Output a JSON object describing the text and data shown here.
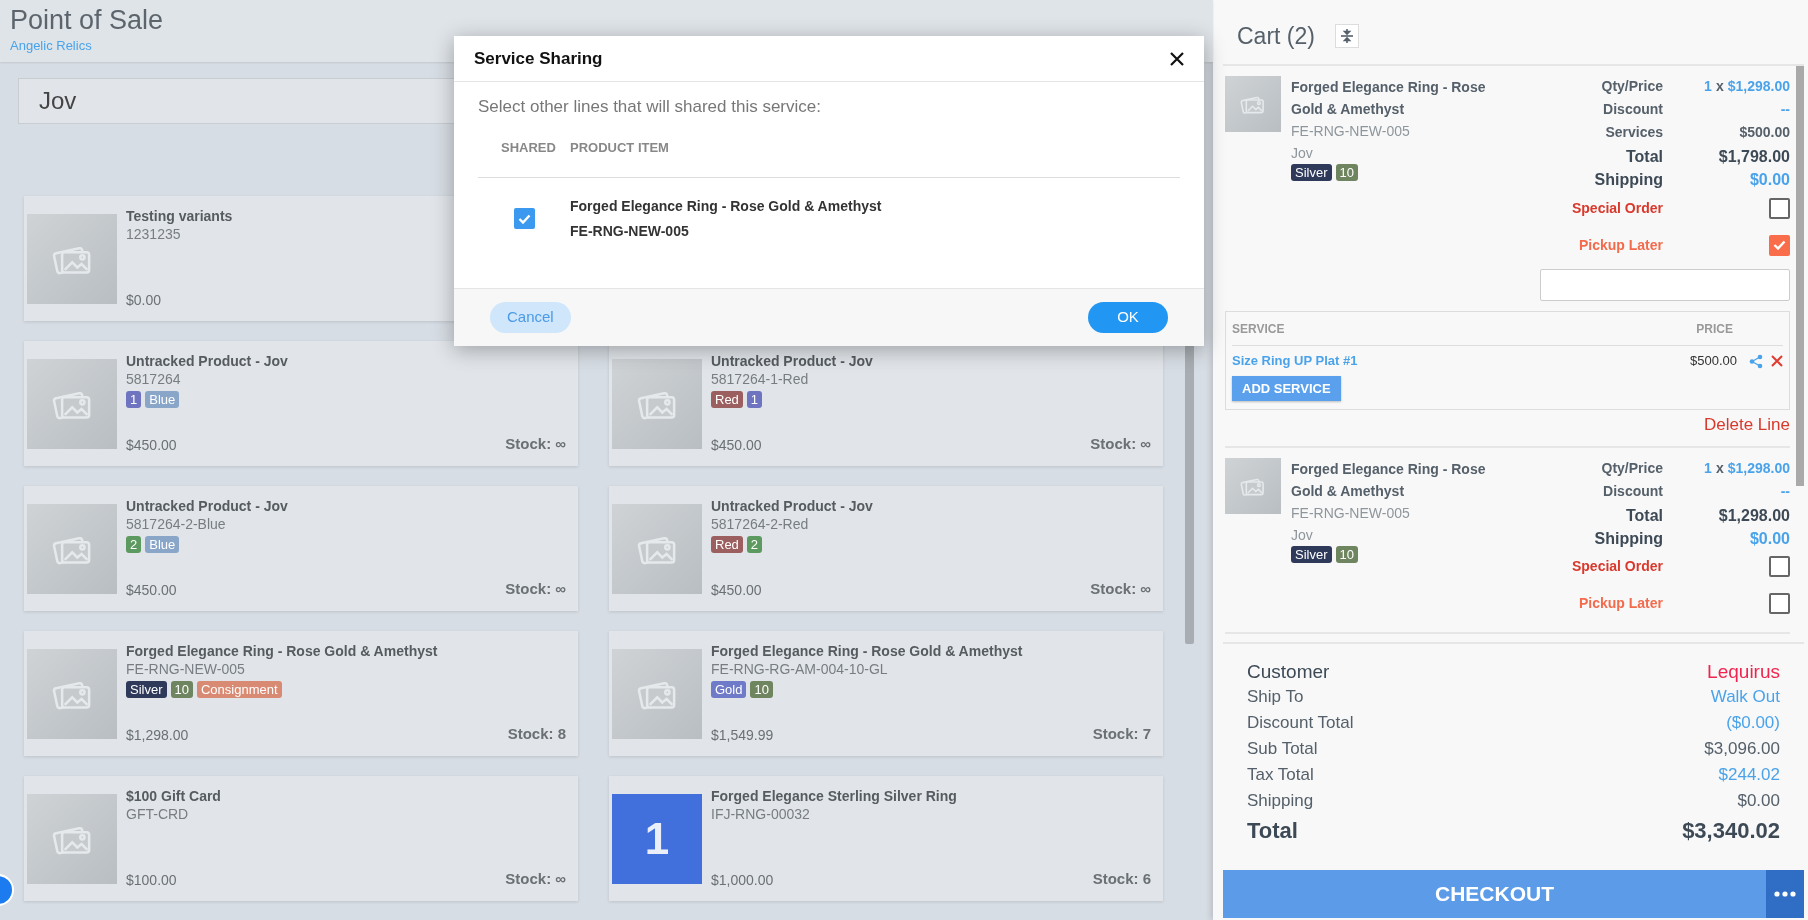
{
  "header": {
    "title": "Point of Sale",
    "subtitle": "Angelic Relics"
  },
  "search": {
    "value": "Jov"
  },
  "products": [
    {
      "name": "Testing variants",
      "sku": "1231235",
      "price": "$0.00",
      "image": {
        "kind": "picture"
      }
    },
    {
      "name": "Untracked Product - Jov",
      "sku": "5817264",
      "tags": [
        {
          "label": "1",
          "color": "#6f74c0"
        },
        {
          "label": "Blue",
          "color": "#89a6c8"
        }
      ],
      "price": "$450.00",
      "stock": "Stock: ∞",
      "image": {
        "kind": "picture"
      }
    },
    {
      "name": "Untracked Product - Jov",
      "sku": "5817264-1-Red",
      "tags": [
        {
          "label": "Red",
          "color": "#9c5f5f"
        },
        {
          "label": "1",
          "color": "#6f74c0"
        }
      ],
      "price": "$450.00",
      "stock": "Stock: ∞",
      "image": {
        "kind": "picture"
      }
    },
    {
      "name": "Untracked Product - Jov",
      "sku": "5817264-2-Blue",
      "tags": [
        {
          "label": "2",
          "color": "#5c9a5f"
        },
        {
          "label": "Blue",
          "color": "#89a6c8"
        }
      ],
      "price": "$450.00",
      "stock": "Stock: ∞",
      "image": {
        "kind": "picture"
      }
    },
    {
      "name": "Untracked Product - Jov",
      "sku": "5817264-2-Red",
      "tags": [
        {
          "label": "Red",
          "color": "#9c5f5f"
        },
        {
          "label": "2",
          "color": "#5c9a5f"
        }
      ],
      "price": "$450.00",
      "stock": "Stock: ∞",
      "image": {
        "kind": "picture"
      }
    },
    {
      "name": "Forged Elegance Ring - Rose Gold & Amethyst",
      "sku": "FE-RNG-NEW-005",
      "tags": [
        {
          "label": "Silver",
          "color": "#2f3a5a"
        },
        {
          "label": "10",
          "color": "#6f8560"
        },
        {
          "label": "Consignment",
          "color": "#d98a73"
        }
      ],
      "price": "$1,298.00",
      "stock": "Stock: 8",
      "image": {
        "kind": "picture"
      }
    },
    {
      "name": "Forged Elegance Ring - Rose Gold & Amethyst",
      "sku": "FE-RNG-RG-AM-004-10-GL",
      "tags": [
        {
          "label": "Gold",
          "color": "#6f7bc8"
        },
        {
          "label": "10",
          "color": "#6f8560"
        }
      ],
      "price": "$1,549.99",
      "stock": "Stock: 7",
      "image": {
        "kind": "picture"
      }
    },
    {
      "name": "$100 Gift Card",
      "sku": "GFT-CRD",
      "price": "$100.00",
      "stock": "Stock: ∞",
      "image": {
        "kind": "picture"
      }
    },
    {
      "name": "Forged Elegance Sterling Silver Ring",
      "sku": "IFJ-RNG-00032",
      "price": "$1,000.00",
      "stock": "Stock: 6",
      "image": {
        "kind": "number",
        "text": "1"
      }
    }
  ],
  "cart": {
    "title": "Cart (2)",
    "lines": [
      {
        "name": "Forged Elegance Ring - Rose Gold & Amethyst",
        "sku": "FE-RNG-NEW-005",
        "vendor": "Jov",
        "tags": [
          {
            "label": "Silver",
            "color": "#2f3a5a"
          },
          {
            "label": "10",
            "color": "#6f8560"
          }
        ],
        "rows": [
          {
            "kind": "qty",
            "label": "Qty/Price",
            "qty": "1",
            "times": "x",
            "price": "$1,298.00"
          },
          {
            "kind": "link",
            "label": "Discount",
            "value": "--"
          },
          {
            "kind": "plain",
            "label": "Services",
            "value": "$500.00"
          },
          {
            "kind": "total",
            "label": "Total",
            "value": "$1,798.00"
          },
          {
            "kind": "shipping",
            "label": "Shipping",
            "value": "$0.00"
          }
        ],
        "special_order": {
          "label": "Special Order",
          "checked": false
        },
        "pickup_later": {
          "label": "Pickup Later",
          "checked": true
        },
        "note_field": true,
        "services": {
          "columns": [
            "SERVICE",
            "PRICE"
          ],
          "items": [
            {
              "name": "Size Ring UP Plat #1",
              "price": "$500.00"
            }
          ],
          "add_label": "ADD SERVICE"
        },
        "delete_label": "Delete Line"
      },
      {
        "name": "Forged Elegance Ring - Rose Gold & Amethyst",
        "sku": "FE-RNG-NEW-005",
        "vendor": "Jov",
        "tags": [
          {
            "label": "Silver",
            "color": "#2f3a5a"
          },
          {
            "label": "10",
            "color": "#6f8560"
          }
        ],
        "rows": [
          {
            "kind": "qty",
            "label": "Qty/Price",
            "qty": "1",
            "times": "x",
            "price": "$1,298.00"
          },
          {
            "kind": "link",
            "label": "Discount",
            "value": "--"
          },
          {
            "kind": "total",
            "label": "Total",
            "value": "$1,298.00"
          },
          {
            "kind": "shipping",
            "label": "Shipping",
            "value": "$0.00"
          }
        ],
        "special_order": {
          "label": "Special Order",
          "checked": false
        },
        "pickup_later": {
          "label": "Pickup Later",
          "checked": false
        },
        "note_field": false
      }
    ],
    "summary": [
      {
        "kind": "customer",
        "label": "Customer",
        "value": "Lequirus"
      },
      {
        "kind": "link",
        "label": "Ship To",
        "value": "Walk Out"
      },
      {
        "kind": "link",
        "label": "Discount Total",
        "value": "($0.00)"
      },
      {
        "kind": "plain",
        "label": "Sub Total",
        "value": "$3,096.00"
      },
      {
        "kind": "link",
        "label": "Tax Total",
        "value": "$244.02"
      },
      {
        "kind": "plain",
        "label": "Shipping",
        "value": "$0.00"
      },
      {
        "kind": "total",
        "label": "Total",
        "value": "$3,340.02"
      }
    ],
    "checkout": "CHECKOUT"
  },
  "modal": {
    "title": "Service Sharing",
    "prompt": "Select other lines that will shared this service:",
    "columns": [
      "SHARED",
      "PRODUCT ITEM"
    ],
    "rows": [
      {
        "name": "Forged Elegance Ring - Rose Gold & Amethyst",
        "sku": "FE-RNG-NEW-005",
        "checked": true
      }
    ],
    "cancel": "Cancel",
    "ok": "OK"
  }
}
